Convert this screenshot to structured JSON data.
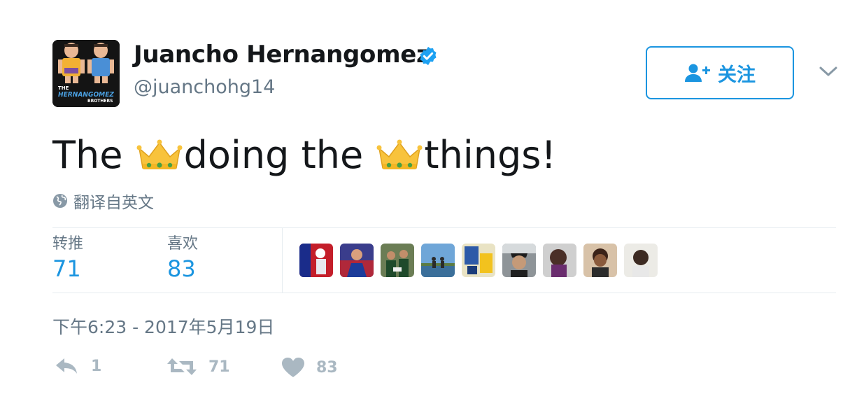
{
  "author": {
    "display_name": "Juancho Hernangomez",
    "handle": "@juanchohg14",
    "verified": true,
    "avatar_icon": "brothers-cartoon-avatar",
    "avatar_text_top": "THE",
    "avatar_text_main": "HERNANGOMEZ",
    "avatar_text_bottom": "BROTHERS"
  },
  "follow_button": {
    "label": "关注",
    "icon": "add-user-icon"
  },
  "tweet": {
    "segments": [
      "The ",
      "doing the ",
      "things!"
    ],
    "emoji": "crown"
  },
  "translate_label": "翻译自英文",
  "stats": {
    "retweets_label": "转推",
    "retweets_count": "71",
    "likes_label": "喜欢",
    "likes_count": "83"
  },
  "timestamp": "下午6:23 - 2017年5月19日",
  "actions": {
    "reply_count": "1",
    "retweet_count": "71",
    "like_count": "83"
  },
  "colors": {
    "accent": "#1b95e0",
    "secondary_text": "#657786",
    "action_gray": "#aab8c2",
    "divider": "#e6ecf0"
  }
}
